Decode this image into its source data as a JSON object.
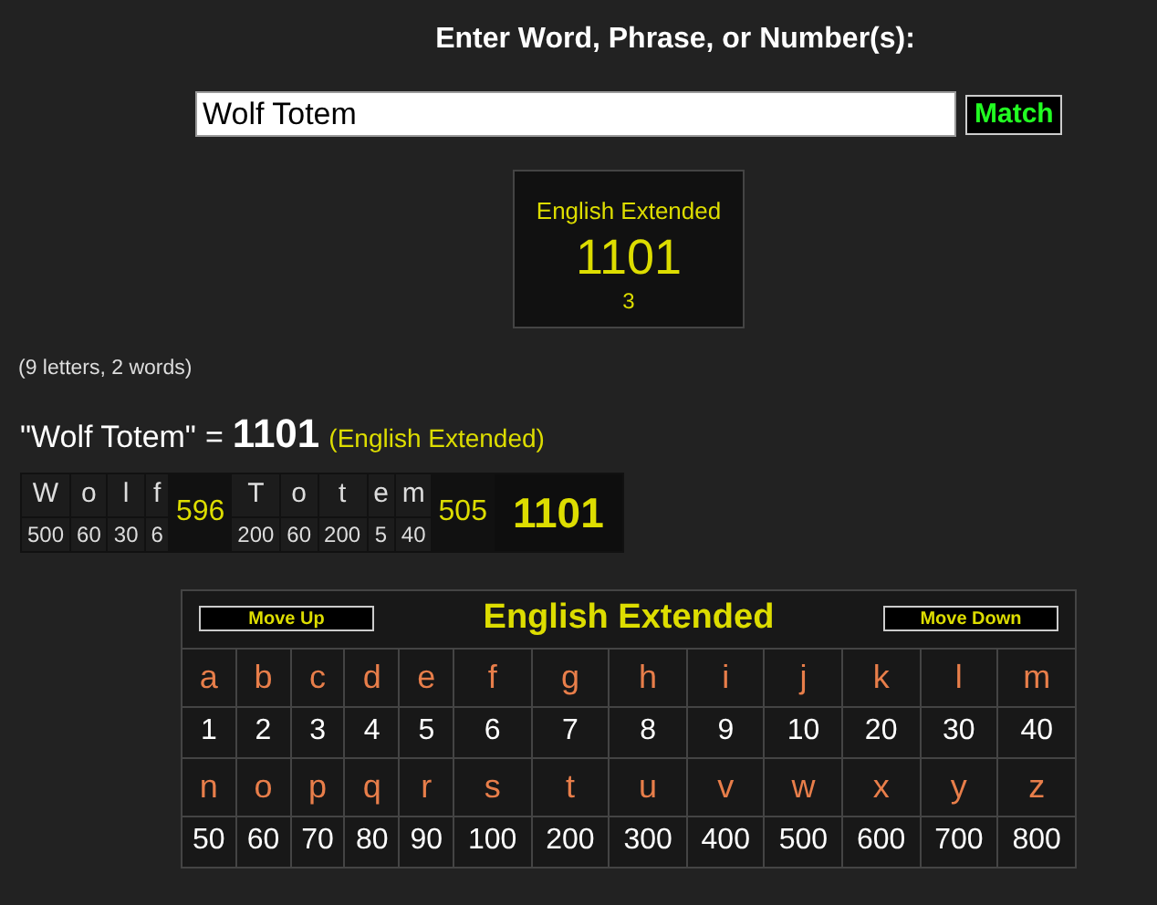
{
  "heading": "Enter Word, Phrase, or Number(s):",
  "input": {
    "value": "Wolf Totem"
  },
  "match_button": "Match",
  "result_card": {
    "cipher": "English Extended",
    "value": "1101",
    "count": "3"
  },
  "stats": "(9 letters, 2 words)",
  "equation": {
    "phrase": "\"Wolf Totem\"",
    "equals": "=",
    "value": "1101",
    "cipher": "(English Extended)"
  },
  "breakdown": {
    "words": [
      {
        "letters": [
          {
            "letter": "W",
            "value": "500"
          },
          {
            "letter": "o",
            "value": "60"
          },
          {
            "letter": "l",
            "value": "30"
          },
          {
            "letter": "f",
            "value": "6"
          }
        ],
        "sum": "596"
      },
      {
        "letters": [
          {
            "letter": "T",
            "value": "200"
          },
          {
            "letter": "o",
            "value": "60"
          },
          {
            "letter": "t",
            "value": "200"
          },
          {
            "letter": "e",
            "value": "5"
          },
          {
            "letter": "m",
            "value": "40"
          }
        ],
        "sum": "505"
      }
    ],
    "total": "1101"
  },
  "cipher_table": {
    "move_up": "Move Up",
    "title": "English Extended",
    "move_down": "Move Down",
    "rows": [
      {
        "letters": [
          "a",
          "b",
          "c",
          "d",
          "e",
          "f",
          "g",
          "h",
          "i",
          "j",
          "k",
          "l",
          "m"
        ],
        "values": [
          "1",
          "2",
          "3",
          "4",
          "5",
          "6",
          "7",
          "8",
          "9",
          "10",
          "20",
          "30",
          "40"
        ]
      },
      {
        "letters": [
          "n",
          "o",
          "p",
          "q",
          "r",
          "s",
          "t",
          "u",
          "v",
          "w",
          "x",
          "y",
          "z"
        ],
        "values": [
          "50",
          "60",
          "70",
          "80",
          "90",
          "100",
          "200",
          "300",
          "400",
          "500",
          "600",
          "700",
          "800"
        ]
      }
    ]
  }
}
